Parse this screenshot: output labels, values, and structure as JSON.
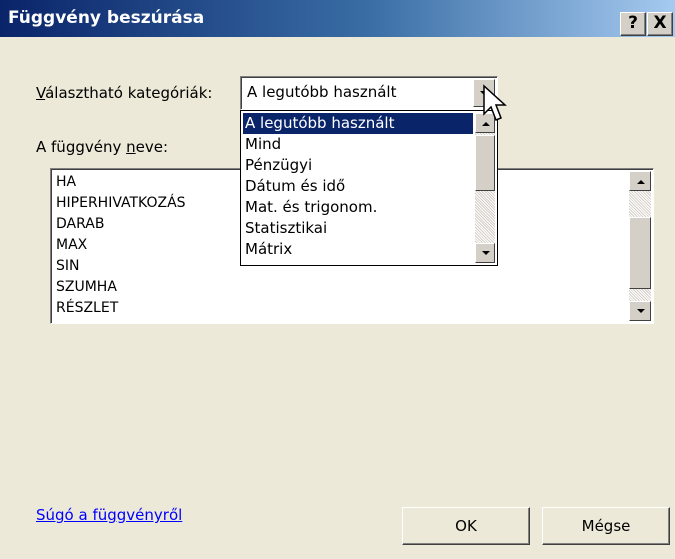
{
  "window": {
    "title": "Függvény beszúrása",
    "help_button": "?",
    "close_button": "X"
  },
  "category": {
    "label_prefix": "",
    "label_accel": "V",
    "label_rest": "álasztható kategóriák:",
    "selected_value": "A legutóbb használt",
    "options": [
      "A legutóbb használt",
      "Mind",
      "Pénzügyi",
      "Dátum és idő",
      "Mat. és trigonom.",
      "Statisztikai",
      "Mátrix"
    ]
  },
  "function_list": {
    "label_prefix": "A függvény ",
    "label_accel": "n",
    "label_rest": "eve:",
    "items": [
      "HA",
      "HIPERHIVATKOZÁS",
      "DARAB",
      "MAX",
      "SIN",
      "SZUMHA",
      "RÉSZLET"
    ]
  },
  "footer": {
    "help_link": "Súgó a függvényről",
    "ok_label": "OK",
    "cancel_label": "Mégse"
  },
  "colors": {
    "titlebar_start": "#0a246a",
    "titlebar_end": "#a6caf0",
    "selection": "#0a246a",
    "link": "#0000ff",
    "dialog_bg": "#ece9d8"
  }
}
